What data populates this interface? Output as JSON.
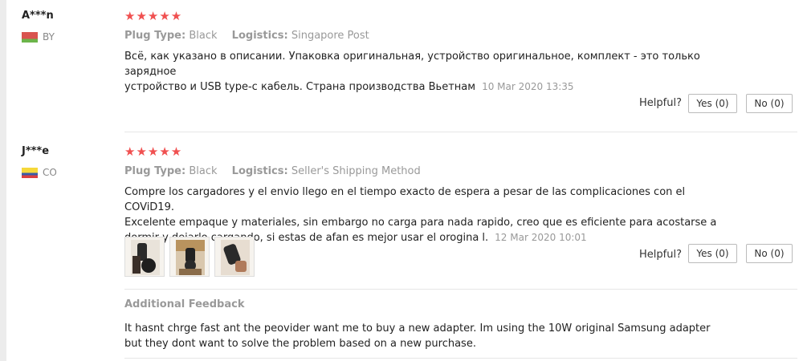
{
  "reviews": [
    {
      "user": "A***n",
      "country": "BY",
      "stars": "★★★★★",
      "plug_label": "Plug Type:",
      "plug_value": "Black",
      "logistics_label": "Logistics:",
      "logistics_value": "Singapore Post",
      "text_line1": "Всё, как указано в описании. Упаковка оригинальная, устройство оригинальное, комплект - это только зарядное",
      "text_line2": "устройство и USB type-c кабель. Страна производства Вьетнам",
      "date": "10 Mar 2020 13:35",
      "helpful_label": "Helpful?",
      "yes_label": "Yes (0)",
      "no_label": "No (0)"
    },
    {
      "user": "J***e",
      "country": "CO",
      "stars": "★★★★★",
      "plug_label": "Plug Type:",
      "plug_value": "Black",
      "logistics_label": "Logistics:",
      "logistics_value": "Seller's Shipping Method",
      "text_line1": "Compre los cargadores y el envio llego en el tiempo exacto de espera a pesar de las complicaciones con el COViD19.",
      "text_line2": "Excelente empaque y materiales, sin embargo no carga para nada rapido, creo que es eficiente para acostarse a",
      "text_line3": "dormir y dejarlo cargando, si estas de afan es mejor usar el orogina l.",
      "date": "12 Mar 2020 10:01",
      "helpful_label": "Helpful?",
      "yes_label": "Yes (0)",
      "no_label": "No (0)",
      "additional_feedback_title": "Additional Feedback",
      "additional_line1": "It hasnt chrge fast ant the peovider want me to buy a new adapter. Im using the 10W original Samsung adapter",
      "additional_line2": "but they dont want to solve the problem based on a new purchase."
    }
  ]
}
